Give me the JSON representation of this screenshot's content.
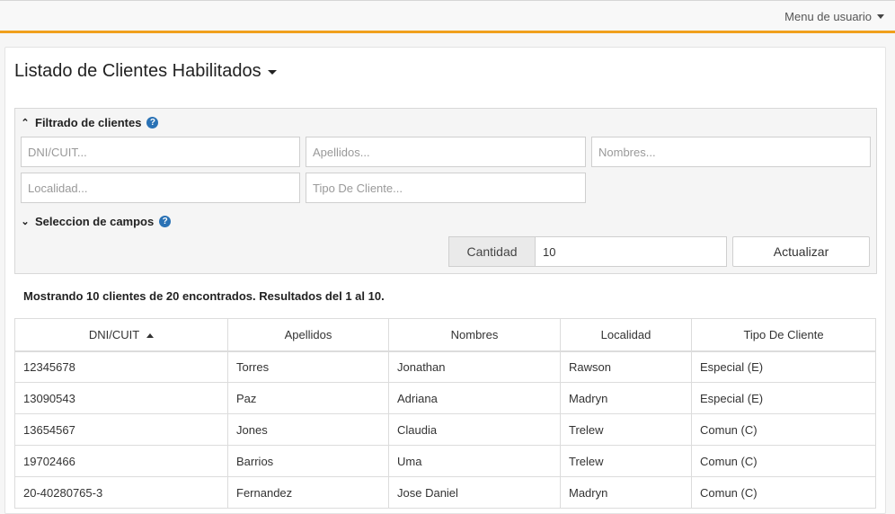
{
  "header": {
    "user_menu_label": "Menu de usuario"
  },
  "page": {
    "title": "Listado de Clientes Habilitados"
  },
  "filters": {
    "heading": "Filtrado de clientes",
    "dni_placeholder": "DNI/CUIT...",
    "apellidos_placeholder": "Apellidos...",
    "nombres_placeholder": "Nombres...",
    "localidad_placeholder": "Localidad...",
    "tipo_placeholder": "Tipo De Cliente...",
    "fields_heading": "Seleccion de campos",
    "cantidad_label": "Cantidad",
    "cantidad_value": "10",
    "update_button": "Actualizar"
  },
  "summary": "Mostrando 10 clientes de 20 encontrados. Resultados del 1 al 10.",
  "table": {
    "columns": [
      "DNI/CUIT",
      "Apellidos",
      "Nombres",
      "Localidad",
      "Tipo De Cliente"
    ],
    "rows": [
      [
        "12345678",
        "Torres",
        "Jonathan",
        "Rawson",
        "Especial (E)"
      ],
      [
        "13090543",
        "Paz",
        "Adriana",
        "Madryn",
        "Especial (E)"
      ],
      [
        "13654567",
        "Jones",
        "Claudia",
        "Trelew",
        "Comun (C)"
      ],
      [
        "19702466",
        "Barrios",
        "Uma",
        "Trelew",
        "Comun (C)"
      ],
      [
        "20-40280765-3",
        "Fernandez",
        "Jose Daniel",
        "Madryn",
        "Comun (C)"
      ]
    ]
  },
  "colors": {
    "accent": "#f0a01c",
    "help_icon": "#2a72b5"
  }
}
